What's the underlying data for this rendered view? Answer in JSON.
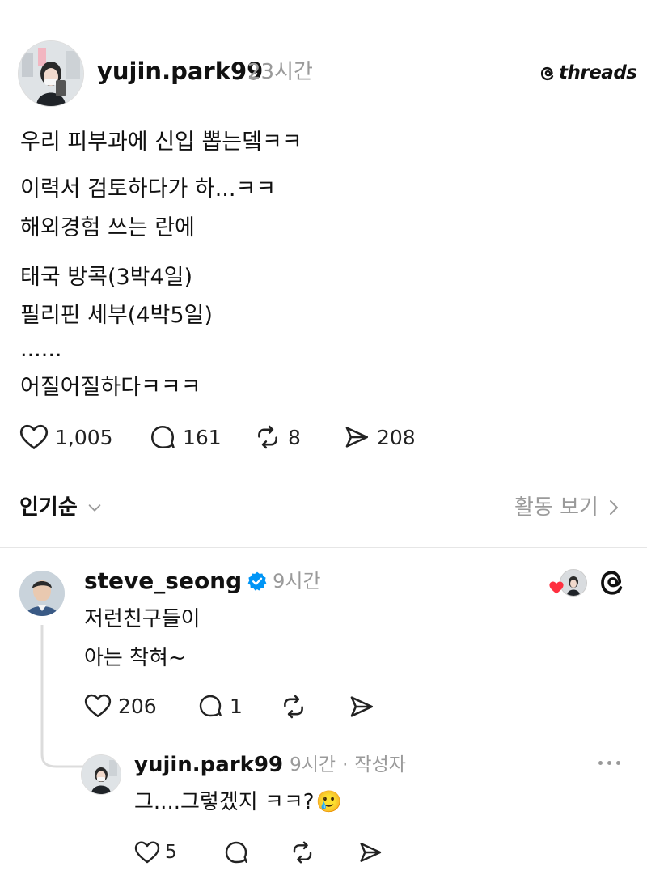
{
  "brand": {
    "logo_text": "threads"
  },
  "post": {
    "username": "yujin.park99",
    "time": "23시간",
    "lines": [
      "우리 피부과에 신입 뽑는뎈ㅋㅋ",
      "이력서 검토하다가 하...ㅋㅋ",
      "해외경험 쓰는 란에",
      "태국 방콕(3박4일)",
      "필리핀 세부(4박5일)",
      "......",
      "어질어질하다ㅋㅋㅋ"
    ],
    "likes": "1,005",
    "comments": "161",
    "reposts": "8",
    "shares": "208"
  },
  "sort": {
    "label": "인기순",
    "activity_label": "활동 보기"
  },
  "reply": {
    "username": "steve_seong",
    "time": "9시간",
    "lines": [
      "저런친구들이",
      "아는 착혀~"
    ],
    "likes": "206",
    "comments": "1"
  },
  "nested_reply": {
    "username": "yujin.park99",
    "time": "9시간",
    "separator": "·",
    "author_tag": "작성자",
    "text": "그....그렇겠지 ㅋㅋ?",
    "emoji": "🥲",
    "likes": "5"
  },
  "colors": {
    "verified": "#0095f6",
    "heart": "#ff3040",
    "muted": "#9a9a9a"
  }
}
